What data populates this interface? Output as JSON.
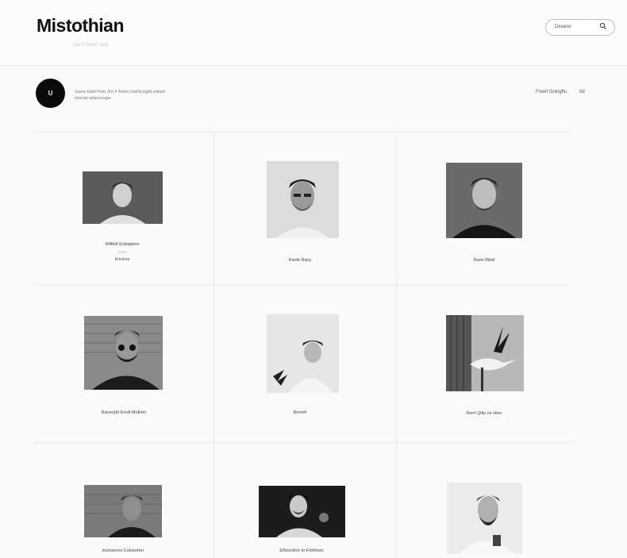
{
  "header": {
    "brand": "Mistothian",
    "tagline": "ma Fmbmr teid",
    "search": {
      "placeholder": "Deserer",
      "icon": "search-icon"
    }
  },
  "profile": {
    "avatar_text": "U",
    "bio_line1": "Gaea Gtiot Potn /Fri /i 4ofoir Iodr0enginl edeed",
    "bio_line2": "Hornet urfanonupe",
    "links": [
      "Frwef Goingflu",
      "Itd"
    ]
  },
  "gallery": [
    {
      "caption": "Willfelt Enlsigitem",
      "sub1": "rrmer",
      "sub2": "Emoirsa"
    },
    {
      "caption": "Ranfe Bany",
      "sub1": "",
      "sub2": ""
    },
    {
      "caption": "Rarie Bihitt",
      "sub1": "",
      "sub2": ""
    },
    {
      "caption": "Racerpfrt Enolf Mothen",
      "sub1": "",
      "sub2": ""
    },
    {
      "caption": "Illorrefr",
      "sub1": "",
      "sub2": ""
    },
    {
      "caption": "Rerrt Qlitz oe Hien",
      "sub1": "",
      "sub2": ""
    },
    {
      "caption": "Inolnsenro Colvenfrer",
      "sub1": "",
      "sub2": ""
    },
    {
      "caption": "Effsorofrnr to Frbtfriom",
      "sub1": "",
      "sub2": ""
    },
    {
      "caption": "",
      "sub1": "",
      "sub2": ""
    }
  ]
}
